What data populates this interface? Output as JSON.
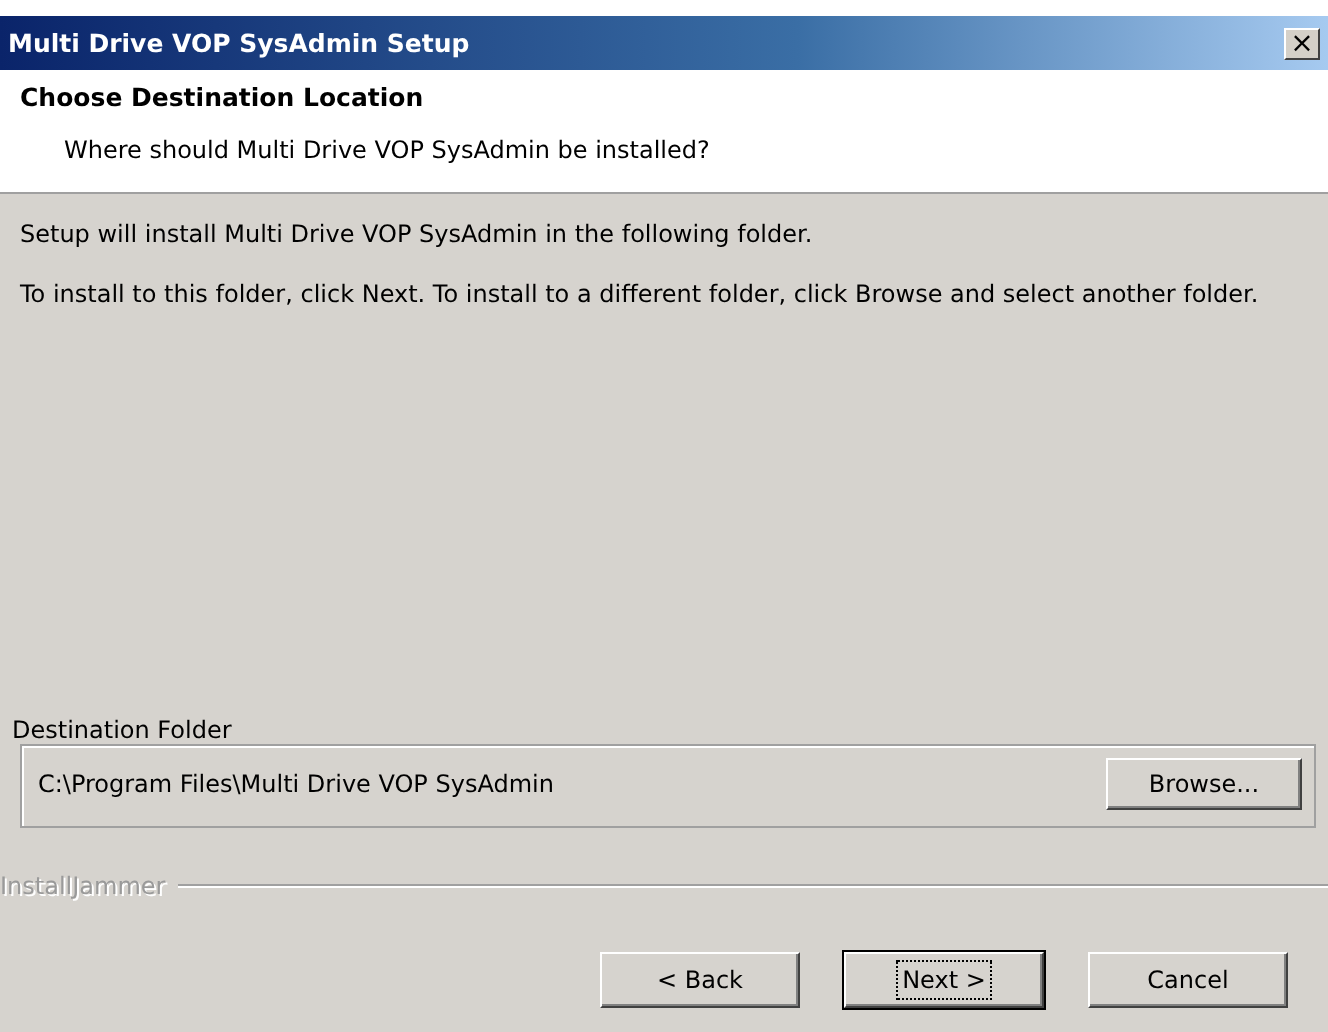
{
  "window": {
    "title": "Multi Drive VOP SysAdmin Setup",
    "close": "×"
  },
  "header": {
    "title": "Choose Destination Location",
    "subtitle": "Where should Multi Drive VOP SysAdmin be installed?"
  },
  "body": {
    "paragraphs": [
      "Setup will install Multi Drive VOP SysAdmin in the following folder.",
      "To install to this folder, click Next.  To install to a different folder, click Browse and select another folder."
    ]
  },
  "destination": {
    "legend": "Destination Folder",
    "path": "C:\\Program Files\\Multi Drive VOP SysAdmin",
    "button": "Browse..."
  },
  "brand": "InstallJammer",
  "buttons": [
    {
      "label": "< Back",
      "default": false
    },
    {
      "label": "Next >",
      "default": true
    },
    {
      "label": "Cancel",
      "default": false
    }
  ]
}
